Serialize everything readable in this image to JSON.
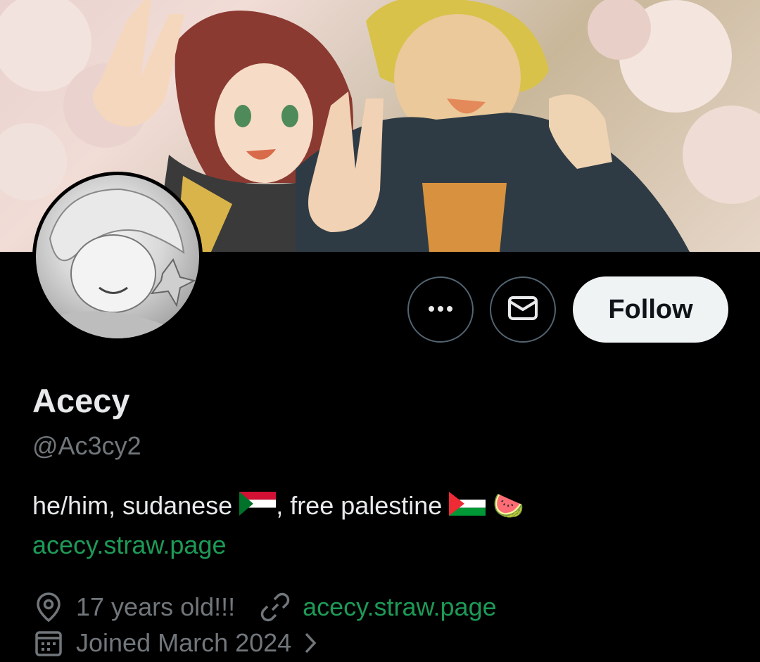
{
  "profile": {
    "display_name": "Acecy",
    "handle": "@Ac3cy2",
    "bio": {
      "text_1": "he/him, sudanese ",
      "text_2": ", free palestine ",
      "flags": [
        "sudan-flag",
        "palestine-flag"
      ],
      "emoji": "🍉",
      "link": "acecy.straw.page"
    },
    "location": "17 years old!!!",
    "website": "acecy.straw.page",
    "joined": "Joined March 2024"
  },
  "actions": {
    "follow_label": "Follow",
    "more_icon": "ellipsis-icon",
    "message_icon": "envelope-icon"
  },
  "colors": {
    "background": "#000000",
    "primary_text": "#e7e9ea",
    "secondary_text": "#71767b",
    "link": "#1d9a57",
    "follow_button_bg": "#eff3f4"
  }
}
